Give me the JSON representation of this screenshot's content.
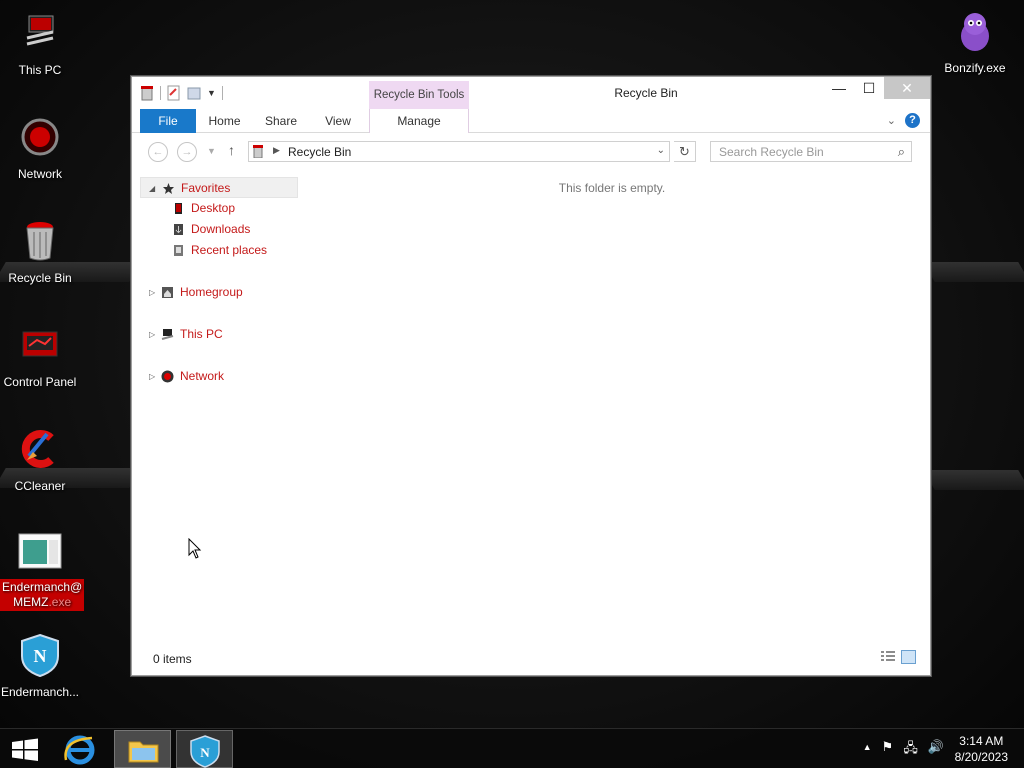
{
  "desktop": {
    "icons": [
      {
        "label": "This PC"
      },
      {
        "label": "Network"
      },
      {
        "label": "Recycle Bin"
      },
      {
        "label": "Control Panel"
      },
      {
        "label": "CCleaner"
      },
      {
        "label": "Endermanch@MEMZ.exe",
        "line1": "Endermanch@",
        "line2": "MEMZ",
        "ext": ".exe"
      },
      {
        "label": "Endermanch..."
      },
      {
        "label": "Bonzify.exe"
      }
    ]
  },
  "window": {
    "title": "Recycle Bin",
    "context_tab": "Recycle Bin Tools",
    "ribbon_tabs": {
      "file": "File",
      "home": "Home",
      "share": "Share",
      "view": "View",
      "manage": "Manage"
    },
    "address": {
      "path": "Recycle Bin"
    },
    "search": {
      "placeholder": "Search Recycle Bin"
    },
    "nav_pane": {
      "favorites": "Favorites",
      "desktop": "Desktop",
      "downloads": "Downloads",
      "recent": "Recent places",
      "homegroup": "Homegroup",
      "this_pc": "This PC",
      "network": "Network"
    },
    "empty_message": "This folder is empty.",
    "status": {
      "item_count": "0 items"
    }
  },
  "taskbar": {
    "time": "3:14 AM",
    "date": "8/20/2023"
  },
  "colors": {
    "accent": "#1979ca",
    "nav_text": "#c41a1a",
    "context_tab": "#efd9f2"
  }
}
